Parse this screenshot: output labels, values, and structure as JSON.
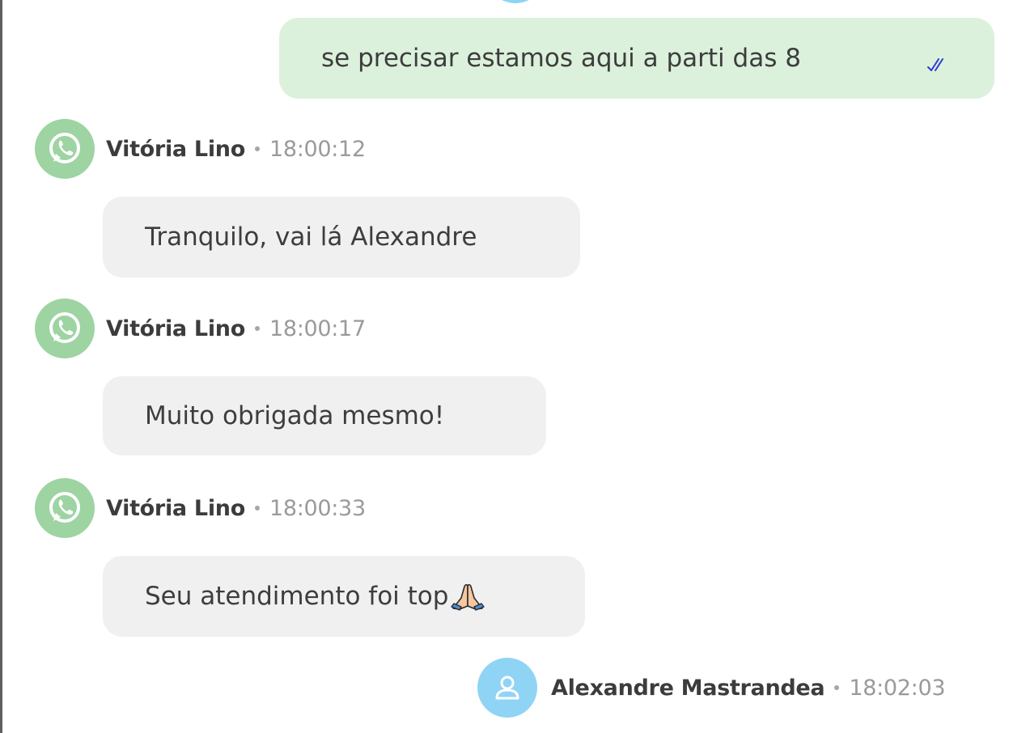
{
  "messages": [
    {
      "direction": "sent",
      "text": "se precisar estamos aqui a parti das 8",
      "status_icon": "double-check-icon",
      "status_color": "#2d3cd6"
    },
    {
      "direction": "received",
      "sender": "Vitória Lino",
      "time": "18:00:12",
      "channel_icon": "whatsapp-icon",
      "text": "Tranquilo, vai lá Alexandre"
    },
    {
      "direction": "received",
      "sender": "Vitória Lino",
      "time": "18:00:17",
      "channel_icon": "whatsapp-icon",
      "text": "Muito obrigada mesmo!"
    },
    {
      "direction": "received",
      "sender": "Vitória Lino",
      "time": "18:00:33",
      "channel_icon": "whatsapp-icon",
      "text": "Seu atendimento foi top",
      "emoji": "folded-hands"
    },
    {
      "direction": "sent-header",
      "sender": "Alexandre Mastrandea",
      "time": "18:02:03",
      "avatar_icon": "user-icon"
    }
  ],
  "colors": {
    "sent_bubble": "#dcf1dc",
    "received_bubble": "#f0f0f0",
    "whatsapp_avatar": "#9dd4a2",
    "agent_avatar": "#8fd4f5",
    "timestamp": "#9a9a9a",
    "sender_name": "#3c3c3c"
  }
}
